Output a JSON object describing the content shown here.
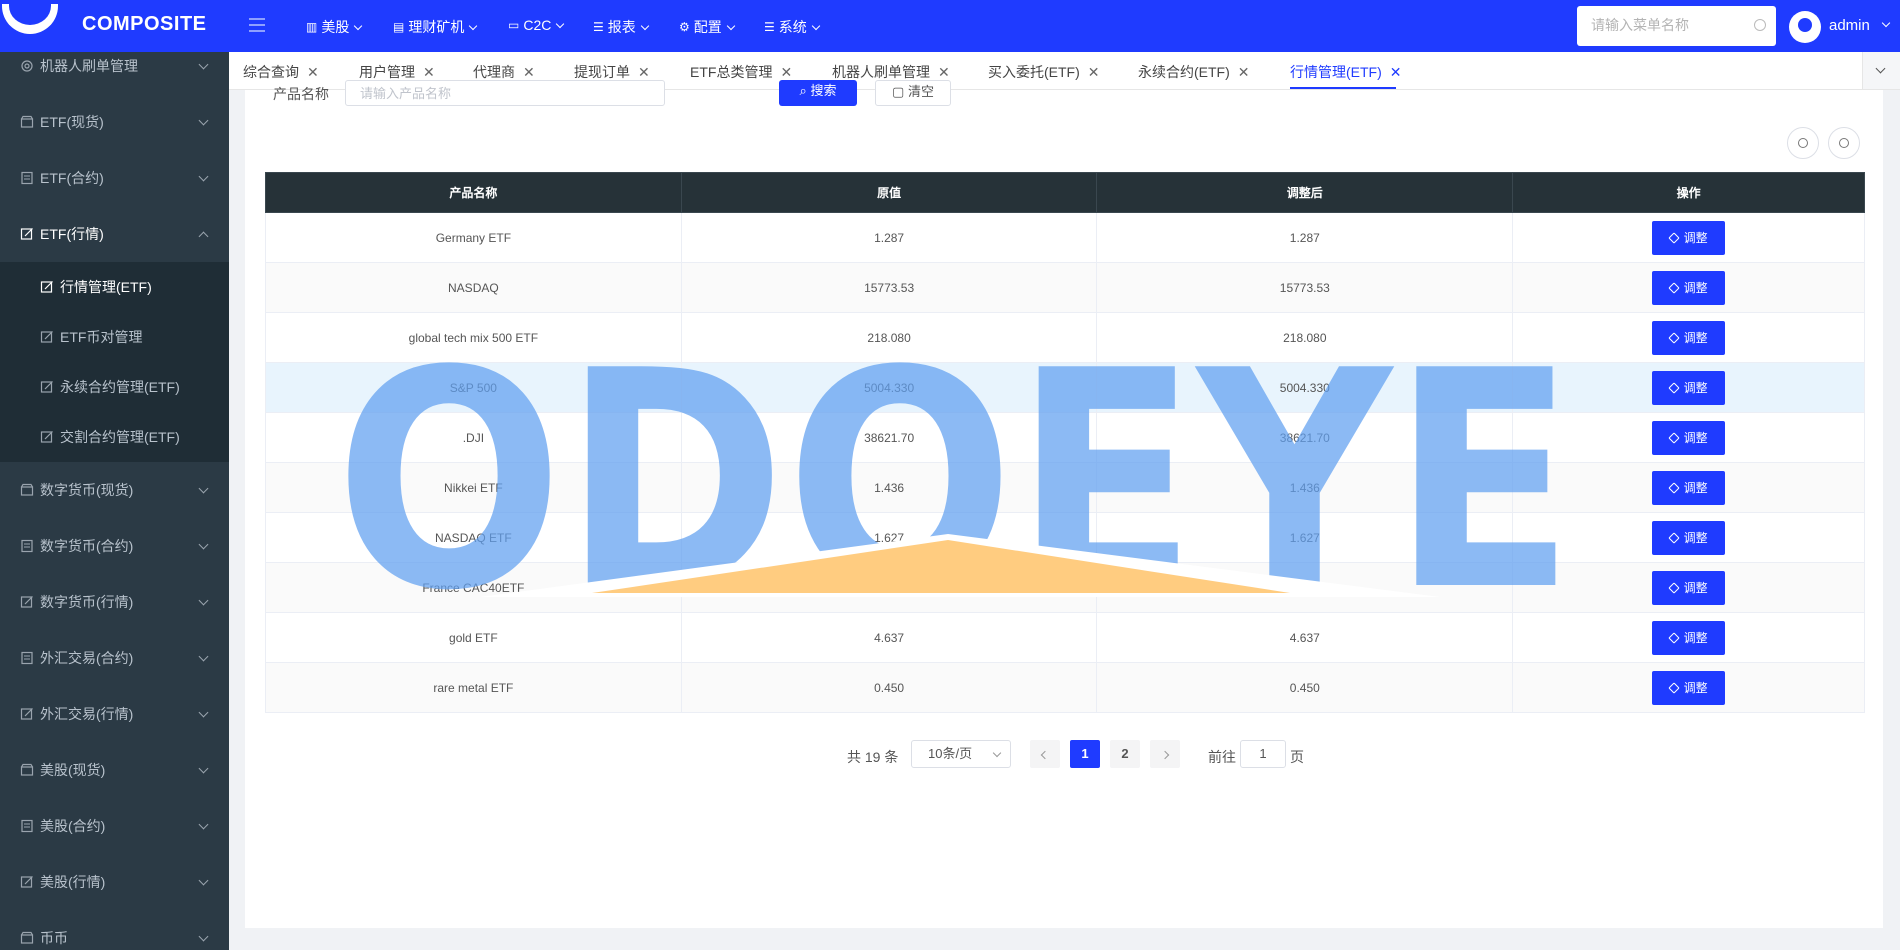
{
  "brand": {
    "name": "COMPOSITE"
  },
  "sidebar": {
    "items": [
      {
        "label": "机器人刷单管理",
        "icon": "gear-icon"
      },
      {
        "label": "ETF(现货)",
        "icon": "store-icon"
      },
      {
        "label": "ETF(合约)",
        "icon": "document-icon"
      },
      {
        "label": "ETF(行情)",
        "icon": "edit-icon",
        "open": true
      }
    ],
    "submenu": [
      {
        "label": "行情管理(ETF)",
        "active": true
      },
      {
        "label": "ETF币对管理"
      },
      {
        "label": "永续合约管理(ETF)"
      },
      {
        "label": "交割合约管理(ETF)"
      }
    ],
    "items_after": [
      {
        "label": "数字货币(现货)",
        "icon": "store-icon"
      },
      {
        "label": "数字货币(合约)",
        "icon": "document-icon"
      },
      {
        "label": "数字货币(行情)",
        "icon": "edit-icon"
      },
      {
        "label": "外汇交易(合约)",
        "icon": "document-icon"
      },
      {
        "label": "外汇交易(行情)",
        "icon": "edit-icon"
      },
      {
        "label": "美股(现货)",
        "icon": "store-icon"
      },
      {
        "label": "美股(合约)",
        "icon": "document-icon"
      },
      {
        "label": "美股(行情)",
        "icon": "edit-icon"
      },
      {
        "label": "币币",
        "icon": "store-icon"
      }
    ]
  },
  "topnav": {
    "items": [
      {
        "label": "美股",
        "icon": "chart-icon"
      },
      {
        "label": "理财矿机",
        "icon": "list-icon"
      },
      {
        "label": "C2C",
        "icon": "card-icon"
      },
      {
        "label": "报表",
        "icon": "list-icon"
      },
      {
        "label": "配置",
        "icon": "gear-icon"
      },
      {
        "label": "系统",
        "icon": "list-icon"
      }
    ],
    "search_placeholder": "请输入菜单名称",
    "username": "admin"
  },
  "tabs": [
    {
      "label": "综合查询"
    },
    {
      "label": "用户管理"
    },
    {
      "label": "代理商"
    },
    {
      "label": "提现订单"
    },
    {
      "label": "ETF总类管理"
    },
    {
      "label": "机器人刷单管理"
    },
    {
      "label": "买入委托(ETF)"
    },
    {
      "label": "永续合约(ETF)"
    },
    {
      "label": "行情管理(ETF)",
      "active": true
    }
  ],
  "filter": {
    "label": "产品名称",
    "placeholder": "请输入产品名称",
    "search_label": "搜索",
    "clear_label": "清空"
  },
  "table": {
    "headers": [
      "产品名称",
      "原值",
      "调整后",
      "操作"
    ],
    "action_label": "调整",
    "rows": [
      {
        "name": "Germany ETF",
        "original": "1.287",
        "adjusted": "1.287"
      },
      {
        "name": "NASDAQ",
        "original": "15773.53",
        "adjusted": "15773.53"
      },
      {
        "name": "global tech mix 500 ETF",
        "original": "218.080",
        "adjusted": "218.080"
      },
      {
        "name": "S&P 500",
        "original": "5004.330",
        "adjusted": "5004.330"
      },
      {
        "name": ".DJI",
        "original": "38621.70",
        "adjusted": "38621.70"
      },
      {
        "name": "Nikkei ETF",
        "original": "1.436",
        "adjusted": "1.436"
      },
      {
        "name": "NASDAQ ETF",
        "original": "1.627",
        "adjusted": "1.627"
      },
      {
        "name": "France CAC40ETF",
        "original": "1.555",
        "adjusted": "1.555"
      },
      {
        "name": "gold ETF",
        "original": "4.637",
        "adjusted": "4.637"
      },
      {
        "name": "rare metal ETF",
        "original": "0.450",
        "adjusted": "0.450"
      }
    ]
  },
  "pagination": {
    "total_text": "共 19 条",
    "page_size": "10条/页",
    "pages": [
      "1",
      "2"
    ],
    "current": "1",
    "goto_label": "前往",
    "goto_value": "1",
    "page_suffix": "页"
  },
  "watermark": {
    "text": "ODOEYE"
  },
  "colors": {
    "primary": "#1f3bff",
    "sidebar": "#2b3a45",
    "table_header": "#263238"
  }
}
